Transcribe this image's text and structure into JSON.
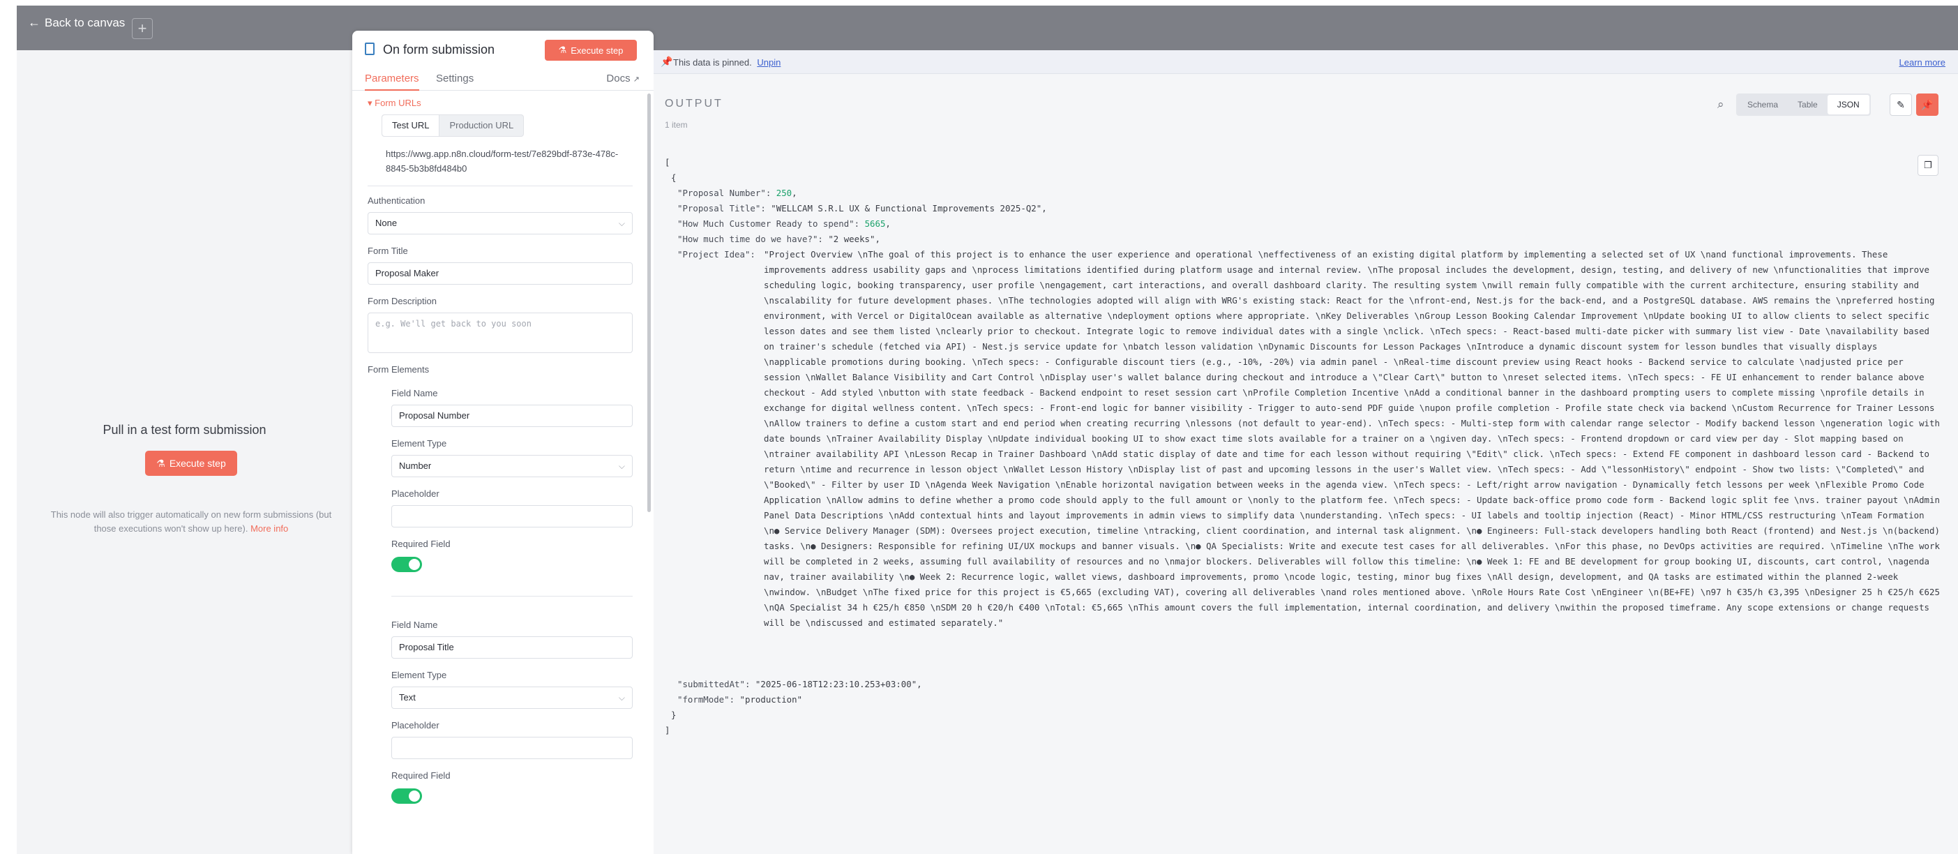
{
  "topbar": {
    "back_label": "Back to canvas",
    "plus_label": "+"
  },
  "left_panel": {
    "title": "Pull in a test form submission",
    "execute_label": "Execute step",
    "note": "This node will also trigger automatically on new form submissions (but those executions won't show up here).",
    "more_info": "More info"
  },
  "params": {
    "node_title": "On form submission",
    "execute_label": "Execute step",
    "tabs": [
      "Parameters",
      "Settings"
    ],
    "docs_label": "Docs",
    "form_urls_label": "Form URLs",
    "url_tabs": [
      "Test URL",
      "Production URL"
    ],
    "test_url": "https://wwg.app.n8n.cloud/form-test/7e829bdf-873e-478c-8845-5b3b8fd484b0",
    "authentication_label": "Authentication",
    "authentication_value": "None",
    "form_title_label": "Form Title",
    "form_title_value": "Proposal Maker",
    "form_description_label": "Form Description",
    "form_description_placeholder": "e.g. We'll get back to you soon",
    "form_elements_label": "Form Elements",
    "elements": [
      {
        "field_name_label": "Field Name",
        "field_name": "Proposal Number",
        "type_label": "Element Type",
        "type": "Number",
        "placeholder_label": "Placeholder",
        "required_label": "Required Field",
        "required": true
      },
      {
        "field_name_label": "Field Name",
        "field_name": "Proposal Title",
        "type_label": "Element Type",
        "type": "Text",
        "placeholder_label": "Placeholder",
        "required_label": "Required Field",
        "required": true
      }
    ]
  },
  "output": {
    "pin_text": "This data is pinned.",
    "unpin_label": "Unpin",
    "learn_more": "Learn more",
    "title": "OUTPUT",
    "items_count": "1 item",
    "view_tabs": [
      "Schema",
      "Table",
      "JSON"
    ],
    "active_view": "JSON",
    "json": {
      "open_bracket": "[",
      "open_brace": "{",
      "proposal_number_key": "\"Proposal Number\":",
      "proposal_number_val": "250",
      "proposal_title_key": "\"Proposal Title\":",
      "proposal_title_val": "\"WELLCAM S.R.L UX & Functional Improvements 2025-Q2\"",
      "ready_key": "\"How Much Customer Ready to spend\":",
      "ready_val": "5665",
      "time_key": "\"How much time do we have?\":",
      "time_val": "\"2 weeks\"",
      "idea_key": "\"Project Idea\":",
      "idea_val": "\"Project Overview \\nThe goal of this project is to enhance the user experience and operational \\neffectiveness of an existing digital platform by implementing a selected set of UX \\nand functional improvements. These improvements address usability gaps and \\nprocess limitations identified during platform usage and internal review. \\nThe proposal includes the development, design, testing, and delivery of new \\nfunctionalities that improve scheduling logic, booking transparency, user profile \\nengagement, cart interactions, and overall dashboard clarity. The resulting system \\nwill remain fully compatible with the current architecture, ensuring stability and \\nscalability for future development phases. \\nThe technologies adopted will align with WRG's existing stack: React for the \\nfront-end, Nest.js for the back-end, and a PostgreSQL database. AWS remains the \\npreferred hosting environment, with Vercel or DigitalOcean available as alternative \\ndeployment options where appropriate. \\nKey Deliverables \\nGroup Lesson Booking Calendar Improvement \\nUpdate booking UI to allow clients to select specific lesson dates and see them listed \\nclearly prior to checkout. Integrate logic to remove individual dates with a single \\nclick. \\nTech specs: - React-based multi-date picker with summary list view - Date \\navailability based on trainer's schedule (fetched via API) - Nest.js service update for \\nbatch lesson validation \\nDynamic Discounts for Lesson Packages \\nIntroduce a dynamic discount system for lesson bundles that visually displays \\napplicable promotions during booking. \\nTech specs: - Configurable discount tiers (e.g., -10%, -20%) via admin panel - \\nReal-time discount preview using React hooks - Backend service to calculate \\nadjusted price per session \\nWallet Balance Visibility and Cart Control \\nDisplay user's wallet balance during checkout and introduce a \\\"Clear Cart\\\" button to \\nreset selected items. \\nTech specs: - FE UI enhancement to render balance above checkout - Add styled \\nbutton with state feedback - Backend endpoint to reset session cart \\nProfile Completion Incentive \\nAdd a conditional banner in the dashboard prompting users to complete missing \\nprofile details in exchange for digital wellness content. \\nTech specs: - Front-end logic for banner visibility - Trigger to auto-send PDF guide \\nupon profile completion - Profile state check via backend \\nCustom Recurrence for Trainer Lessons \\nAllow trainers to define a custom start and end period when creating recurring \\nlessons (not default to year-end). \\nTech specs: - Multi-step form with calendar range selector - Modify backend lesson \\ngeneration logic with date bounds \\nTrainer Availability Display \\nUpdate individual booking UI to show exact time slots available for a trainer on a \\ngiven day. \\nTech specs: - Frontend dropdown or card view per day - Slot mapping based on \\ntrainer availability API \\nLesson Recap in Trainer Dashboard \\nAdd static display of date and time for each lesson without requiring \\\"Edit\\\" click. \\nTech specs: - Extend FE component in dashboard lesson card - Backend to return \\ntime and recurrence in lesson object \\nWallet Lesson History \\nDisplay list of past and upcoming lessons in the user's Wallet view. \\nTech specs: - Add \\\"lessonHistory\\\" endpoint - Show two lists: \\\"Completed\\\" and \\\"Booked\\\" - Filter by user ID \\nAgenda Week Navigation \\nEnable horizontal navigation between weeks in the agenda view. \\nTech specs: - Left/right arrow navigation - Dynamically fetch lessons per week \\nFlexible Promo Code Application \\nAllow admins to define whether a promo code should apply to the full amount or \\nonly to the platform fee. \\nTech specs: - Update back-office promo code form - Backend logic split fee \\nvs. trainer payout \\nAdmin Panel Data Descriptions \\nAdd contextual hints and layout improvements in admin views to simplify data \\nunderstanding. \\nTech specs: - UI labels and tooltip injection (React) - Minor HTML/CSS restructuring \\nTeam Formation \\n●  Service Delivery Manager (SDM): Oversees project execution, timeline \\ntracking, client coordination, and internal task alignment. \\n●  Engineers: Full-stack developers handling both React (frontend) and Nest.js \\n(backend) tasks. \\n●  Designers: Responsible for refining UI/UX mockups and banner visuals. \\n●  QA Specialists: Write and execute test cases for all deliverables. \\nFor this phase, no DevOps activities are required. \\nTimeline \\nThe work will be completed in 2 weeks, assuming full availability of resources and no \\nmajor blockers. Deliverables will follow this timeline: \\n●  Week 1: FE and BE development for group booking UI, discounts, cart control, \\nagenda nav, trainer availability \\n●  Week 2: Recurrence logic, wallet views, dashboard improvements, promo \\ncode logic, testing, minor bug fixes \\nAll design, development, and QA tasks are estimated within the planned 2-week \\nwindow. \\nBudget \\nThe fixed price for this project is €5,665 (excluding VAT), covering all deliverables \\nand roles mentioned above. \\nRole  Hours  Rate  Cost \\nEngineer \\n(BE+FE) \\n97 h  €35/h  €3,395 \\nDesigner  25 h  €25/h  €625 \\nQA Specialist  34 h  €25/h  €850 \\nSDM  20 h  €20/h  €400 \\nTotal: €5,665 \\nThis amount covers the full implementation, internal coordination, and delivery \\nwithin the proposed timeframe. Any scope extensions or change requests will be \\ndiscussed and estimated separately.\"",
      "submitted_key": "\"submittedAt\":",
      "submitted_val": "\"2025-06-18T12:23:10.253+03:00\"",
      "formmode_key": "\"formMode\":",
      "formmode_val": "\"production\"",
      "close_brace": "}",
      "close_bracket": "]"
    }
  },
  "colors": {
    "accent": "#f16d5b",
    "toggle_on": "#1fbf6c",
    "link": "#3b5fcf",
    "number": "#1aa16a"
  },
  "icons": {
    "back": "arrow-left-icon",
    "node": "form-icon",
    "execute": "flask-icon",
    "docs": "external-link-icon",
    "pin": "pin-icon",
    "search": "search-icon",
    "edit": "pencil-icon",
    "pinned": "pin-icon",
    "copy": "copy-icon",
    "chevron": "chevron-down-icon"
  }
}
